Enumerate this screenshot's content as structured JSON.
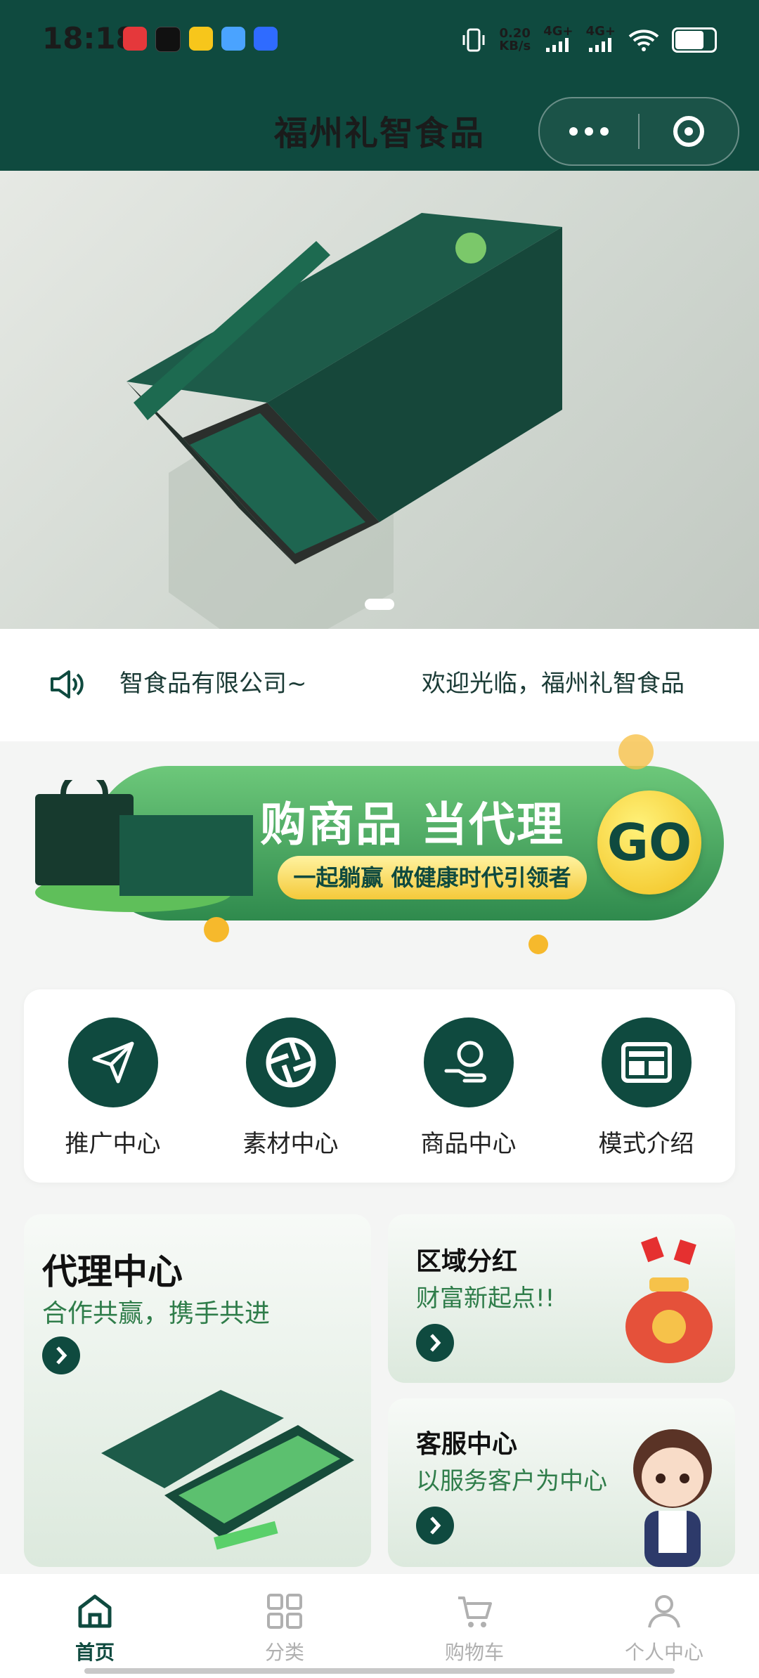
{
  "status": {
    "time": "18:18",
    "speed_value": "0.20",
    "speed_unit": "KB/s",
    "net1": "4G+",
    "net2": "4G+"
  },
  "header": {
    "title": "福州礼智食品"
  },
  "notice": {
    "text_a": "智食品有限公司~",
    "text_b": "欢迎光临，福州礼智食品"
  },
  "promo": {
    "title": "购商品 当代理",
    "subtitle": "一起躺赢 做健康时代引领者",
    "go": "GO"
  },
  "quick": [
    {
      "label": "推广中心",
      "icon": "paper-plane-icon"
    },
    {
      "label": "素材中心",
      "icon": "aperture-icon"
    },
    {
      "label": "商品中心",
      "icon": "hand-coin-icon"
    },
    {
      "label": "模式介绍",
      "icon": "layout-icon"
    }
  ],
  "cards": {
    "agent": {
      "title": "代理中心",
      "subtitle": "合作共赢，携手共进"
    },
    "region": {
      "title": "区域分红",
      "subtitle": "财富新起点!!"
    },
    "service": {
      "title": "客服中心",
      "subtitle": "以服务客户为中心"
    }
  },
  "tabs": [
    {
      "label": "首页",
      "icon": "home-icon"
    },
    {
      "label": "分类",
      "icon": "grid-icon"
    },
    {
      "label": "购物车",
      "icon": "cart-icon"
    },
    {
      "label": "个人中心",
      "icon": "user-icon"
    }
  ],
  "colors": {
    "primary": "#0f4a3f",
    "accent_green": "#2f7d4a",
    "promo_yellow": "#f4c93a"
  }
}
